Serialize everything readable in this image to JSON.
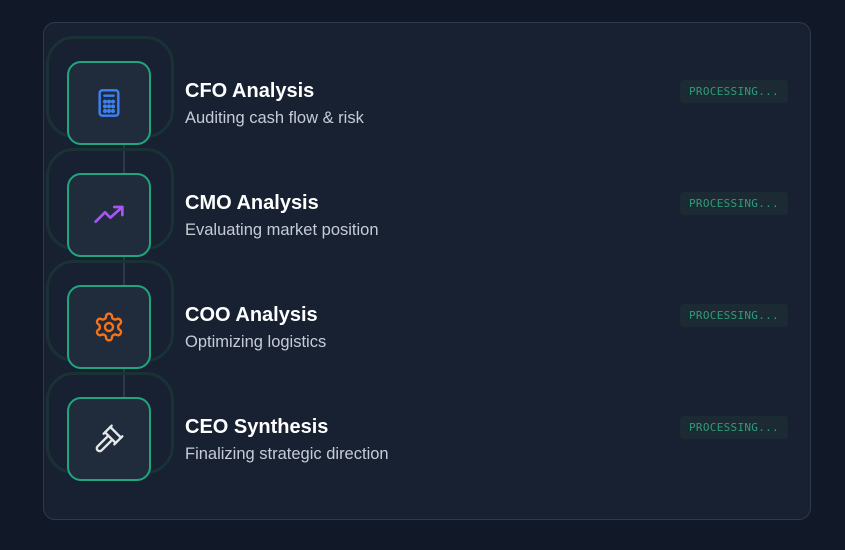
{
  "steps": [
    {
      "title": "CFO Analysis",
      "subtitle": "Auditing cash flow & risk",
      "status": "PROCESSING...",
      "icon": "calculator-icon",
      "icon_color": "#3b82f6"
    },
    {
      "title": "CMO Analysis",
      "subtitle": "Evaluating market position",
      "status": "PROCESSING...",
      "icon": "trending-up-icon",
      "icon_color": "#a855f7"
    },
    {
      "title": "COO Analysis",
      "subtitle": "Optimizing logistics",
      "status": "PROCESSING...",
      "icon": "gear-icon",
      "icon_color": "#f97316"
    },
    {
      "title": "CEO Synthesis",
      "subtitle": "Finalizing strategic direction",
      "status": "PROCESSING...",
      "icon": "gavel-icon",
      "icon_color": "#e5e7eb"
    }
  ],
  "colors": {
    "background": "#111827",
    "panel": "#172131",
    "accent_border": "#21a57d",
    "status_text": "#2f9c7c"
  }
}
